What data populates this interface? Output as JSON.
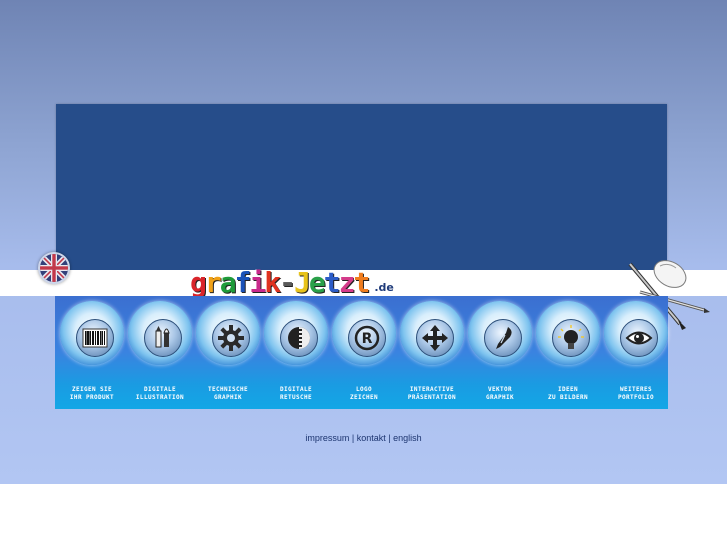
{
  "logo": {
    "letters": [
      "g",
      "r",
      "a",
      "f",
      "i",
      "k",
      "-",
      "J",
      "e",
      "t",
      "z",
      "t"
    ],
    "letter_colors": [
      "#d9252b",
      "#f0a117",
      "#1f9b3a",
      "#1a52b8",
      "#c92a8c",
      "#e03220",
      "#5a5a5a",
      "#e8c31b",
      "#2aa049",
      "#2c5cc6",
      "#d43b8a",
      "#f07d1e"
    ],
    "tld": ".de"
  },
  "nav": [
    {
      "icon": "barcode-icon",
      "line1": "ZEIGEN SIE",
      "line2": "IHR PRODUKT"
    },
    {
      "icon": "paintbrush-pencil-icon",
      "line1": "DIGITALE",
      "line2": "ILLUSTRATION"
    },
    {
      "icon": "gear-icon",
      "line1": "TECHNISCHE",
      "line2": "GRAPHIK"
    },
    {
      "icon": "pixel-halftone-icon",
      "line1": "DIGITALE",
      "line2": "RETUSCHE"
    },
    {
      "icon": "registered-trademark-icon",
      "line1": "LOGO",
      "line2": "ZEICHEN"
    },
    {
      "icon": "four-way-arrows-icon",
      "line1": "INTERACTIVE",
      "line2": "PRÄSENTATION"
    },
    {
      "icon": "pen-nib-icon",
      "line1": "VEKTOR",
      "line2": "GRAPHIK"
    },
    {
      "icon": "light-bulb-icon",
      "line1": "IDEEN",
      "line2": "ZU BILDERN"
    },
    {
      "icon": "eye-icon",
      "line1": "WEITERES",
      "line2": "PORTFOLIO"
    }
  ],
  "footer": {
    "impressum": "impressum",
    "kontakt": "kontakt",
    "english": "english",
    "separator": "|"
  },
  "colors": {
    "panel": "#264d8a",
    "strip_top": "#3b6fd0",
    "strip_bottom": "#13a7e6",
    "footer_text": "#1d3570"
  }
}
